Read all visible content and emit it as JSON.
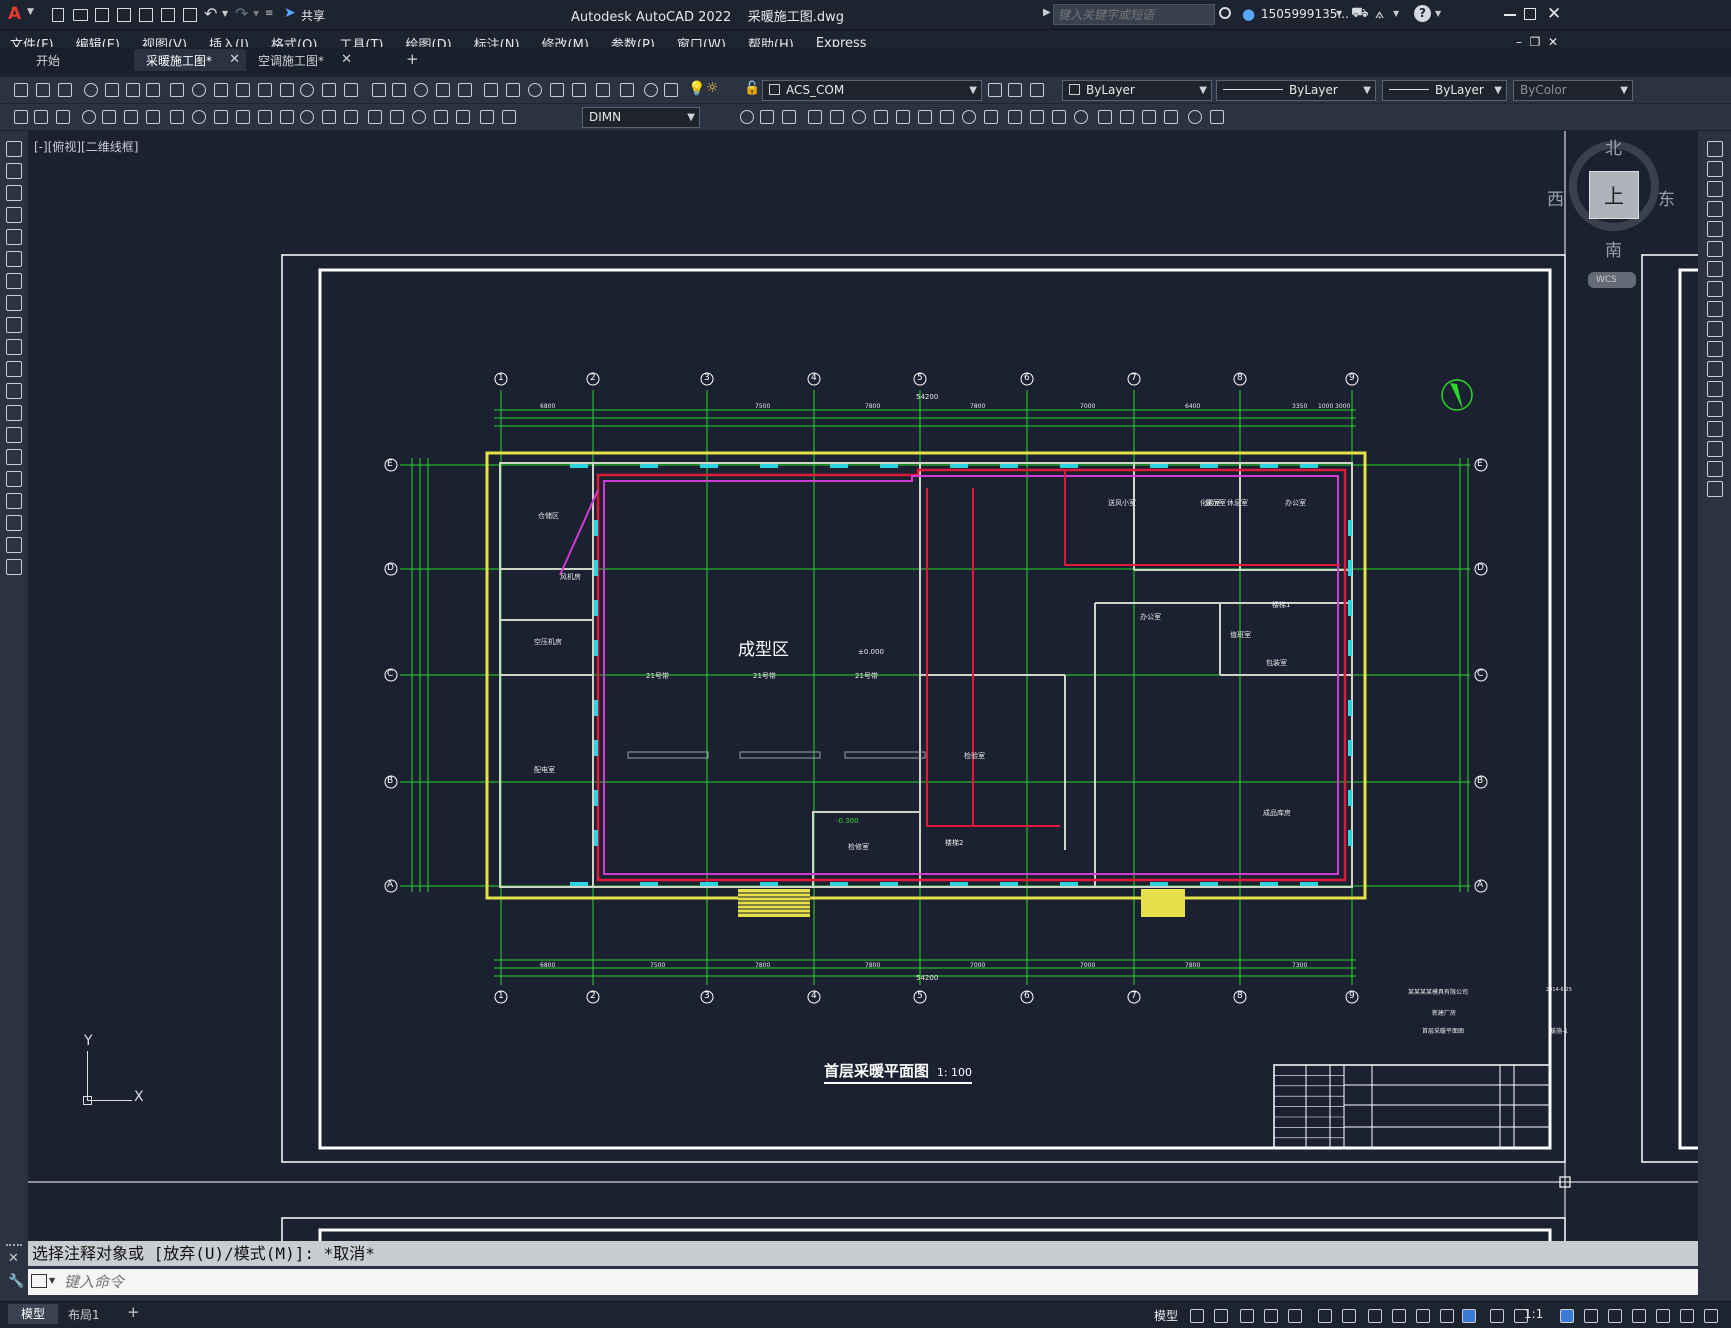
{
  "app": {
    "title": "Autodesk AutoCAD 2022",
    "file": "采暖施工图.dwg",
    "search_placeholder": "键入关键字或短语",
    "user": "1505999135...",
    "share_label": "共享",
    "help_label": "?"
  },
  "menu": [
    "文件(F)",
    "编辑(E)",
    "视图(V)",
    "插入(I)",
    "格式(O)",
    "工具(T)",
    "绘图(D)",
    "标注(N)",
    "修改(M)",
    "参数(P)",
    "窗口(W)",
    "帮助(H)",
    "Express"
  ],
  "tabs": [
    {
      "label": "开始",
      "active": false
    },
    {
      "label": "采暖施工图*",
      "active": true
    },
    {
      "label": "空调施工图*",
      "active": false
    }
  ],
  "tab_add": "+",
  "toolbar": {
    "layer_name": "ACS_COM",
    "color": "ByLayer",
    "linetype": "ByLayer",
    "lineweight": "ByLayer",
    "plotstyle": "ByColor",
    "dim_style": "DIMN"
  },
  "viewport_label": "[-][俯视][二维线框]",
  "viewcube": {
    "north": "北",
    "south": "南",
    "east": "东",
    "west": "西",
    "top": "上",
    "wcs": "WCS"
  },
  "ucs": {
    "x": "X",
    "y": "Y"
  },
  "drawing": {
    "title": "首层采暖平面图",
    "scale": "1: 100",
    "zone_main": "成型区",
    "rooms": [
      "仓储区",
      "风机房",
      "空压机房",
      "配电室",
      "检修室",
      "休息室",
      "办公室",
      "展示室",
      "楼梯1",
      "楼梯2",
      "检验室",
      "成品库房",
      "送风小室",
      "化验室",
      "值班室",
      "办公室",
      "包装室"
    ],
    "grid_numbers": [
      "1",
      "2",
      "3",
      "4",
      "5",
      "6",
      "7",
      "8",
      "9"
    ],
    "grid_letters": [
      "E",
      "D",
      "C",
      "B",
      "A"
    ],
    "overall_dim": "54200",
    "top_dims": [
      "6800",
      "7500",
      "7800",
      "7800",
      "7000",
      "6400",
      "3350",
      "1000",
      "3000"
    ],
    "bottom_dims": [
      "6800",
      "7500",
      "7800",
      "7800",
      "7000",
      "7000",
      "7800",
      "7300"
    ],
    "elev_1": "±0.000",
    "elev_2": "-0.300",
    "label_arrow": "21号带",
    "titleblock": {
      "company": "某某某某模具有限公司",
      "project": "新建厂房",
      "drawing": "首层采暖平面图",
      "sheet": "暖施-1",
      "date": "2014-6-25"
    }
  },
  "command": {
    "history": "选择注释对象或 [放弃(U)/模式(M)]: *取消*",
    "placeholder": "键入命令"
  },
  "status": {
    "model_tab": "模型",
    "layout_tab": "布局1",
    "add": "+",
    "model_space": "模型",
    "scale": "1:1"
  },
  "colors": {
    "canvas": "#1b2130",
    "grid": "#2bd62b",
    "wall": "#e6e14a",
    "pipe_red": "#e0193a",
    "pipe_magenta": "#d13bd1",
    "frame": "#ffffff",
    "cyan": "#2fd3e0"
  }
}
